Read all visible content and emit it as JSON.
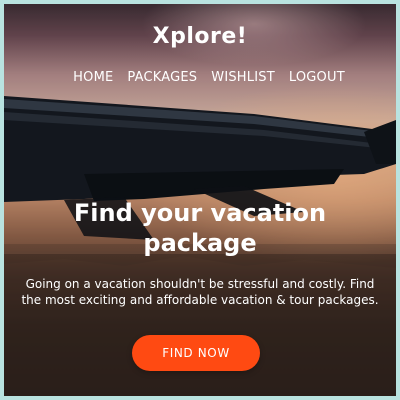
{
  "brand": {
    "name": "Xplore!"
  },
  "nav": {
    "items": [
      {
        "label": "HOME"
      },
      {
        "label": "PACKAGES"
      },
      {
        "label": "WISHLIST"
      },
      {
        "label": "LOGOUT"
      }
    ]
  },
  "hero": {
    "headline_line1": "Find your vacation",
    "headline_line2": "package",
    "subtext": "Going on a vacation shouldn't be stressful and costly. Find the most exciting and affordable vacation & tour packages.",
    "cta_label": "FIND NOW",
    "background_image": "airplane-wing-sunset"
  },
  "colors": {
    "frame": "#b9e3e0",
    "accent": "#ff4a12",
    "text": "#ffffff"
  }
}
